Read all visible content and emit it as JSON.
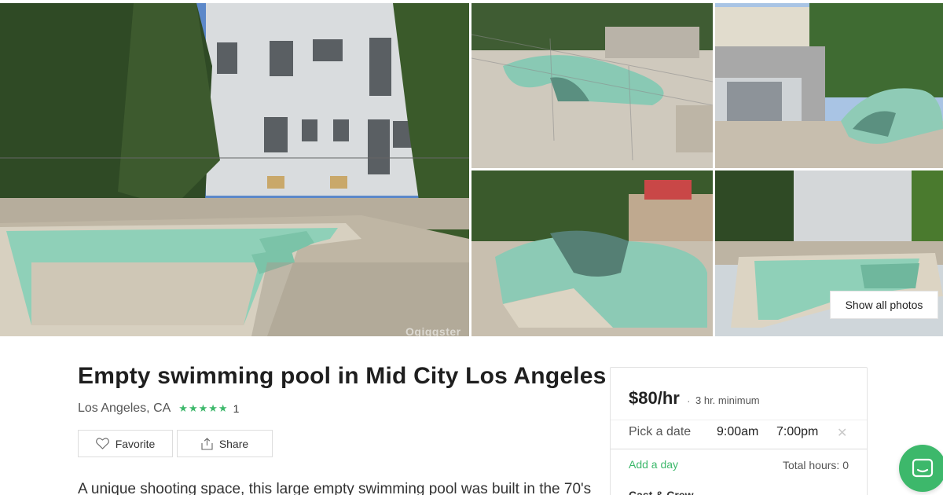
{
  "gallery": {
    "watermark": "Ogiggster",
    "show_all_label": "Show all photos"
  },
  "listing": {
    "title": "Empty swimming pool in Mid City Los Angeles",
    "location": "Los Angeles, CA",
    "rating": 5,
    "rating_count": "1",
    "favorite_label": "Favorite",
    "share_label": "Share",
    "description": "A unique shooting space, this large empty swimming pool was built in the 70's"
  },
  "booking": {
    "price": "$80/hr",
    "separator": "·",
    "minimum": "3 hr. minimum",
    "pick_date": "Pick a date",
    "start_time": "9:00am",
    "end_time": "7:00pm",
    "clear": "✕",
    "add_day": "Add a day",
    "total_hours": "Total hours: 0",
    "cast_crew": "Cast & Crew"
  },
  "colors": {
    "accent": "#3db86b",
    "pool_tile": "#8fd0b8",
    "wall": "#d9dcde",
    "foliage": "#2f4a25"
  },
  "icons": {
    "favorite": "heart-icon",
    "share": "share-icon",
    "stars": "star-icon",
    "chat": "chat-icon"
  }
}
